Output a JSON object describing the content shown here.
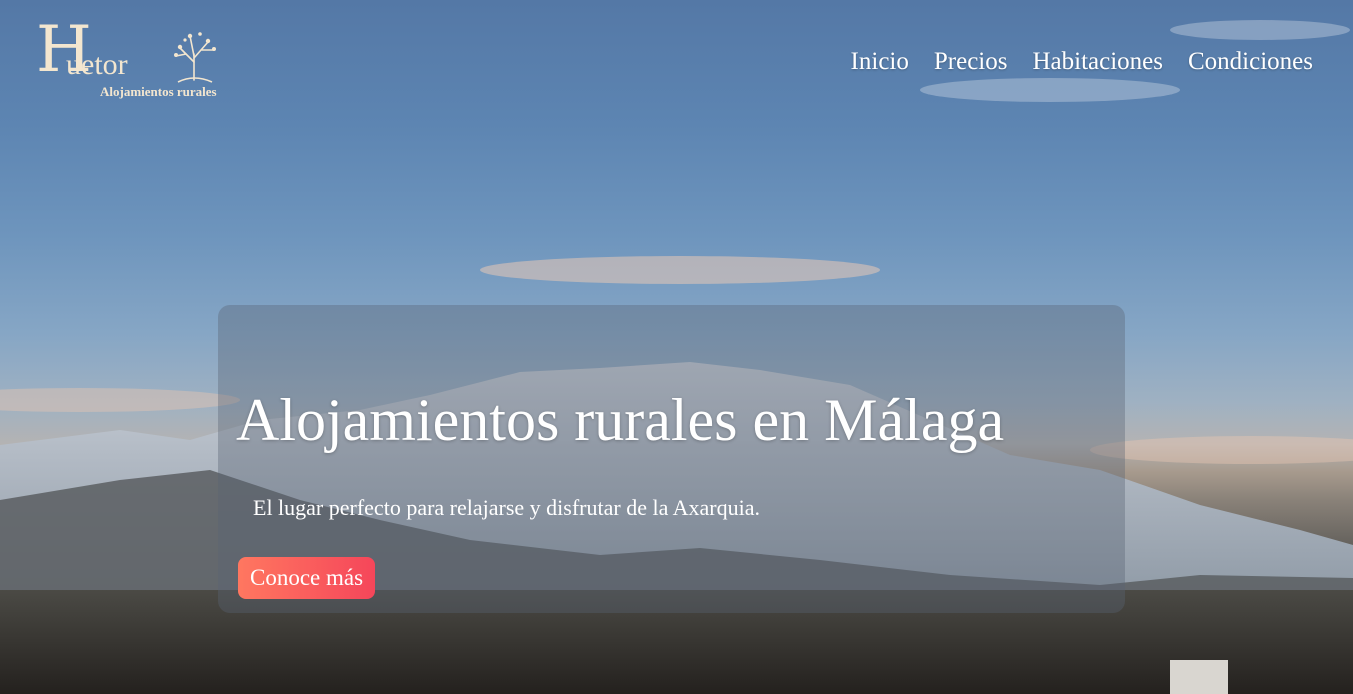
{
  "brand": {
    "initial": "H",
    "word": "uetor",
    "tagline": "Alojamientos rurales",
    "tree_icon": "olive-tree-icon",
    "color": "#f3e6cf"
  },
  "nav": {
    "items": [
      {
        "label": "Inicio"
      },
      {
        "label": "Precios"
      },
      {
        "label": "Habitaciones"
      },
      {
        "label": "Condiciones"
      }
    ]
  },
  "hero": {
    "background": "mountain-landscape-photo",
    "title": "Alojamientos rurales en Málaga",
    "subtitle": "El lugar perfecto para relajarse y disfrutar de la Axarquia.",
    "cta_label": "Conoce más",
    "cta_color": "#f5465a"
  }
}
